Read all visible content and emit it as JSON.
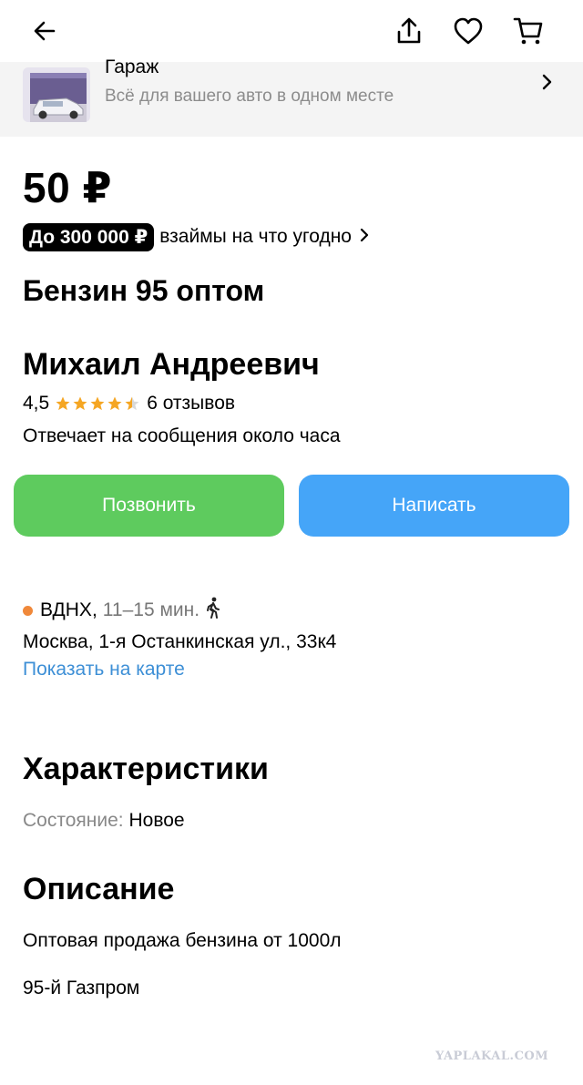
{
  "toolbar": {
    "back_icon": "back-arrow-icon",
    "share_icon": "share-icon",
    "favorite_icon": "heart-icon",
    "cart_icon": "cart-icon"
  },
  "promo": {
    "title": "Гараж",
    "subtitle": "Всё для вашего авто в одном месте"
  },
  "listing": {
    "price": "50 ₽",
    "loan_badge": "До 300 000 ₽",
    "loan_text": "взаймы на что угодно",
    "title": "Бензин 95 оптом"
  },
  "seller": {
    "name": "Михаил Андреевич",
    "rating": "4,5",
    "rating_value": 4.5,
    "reviews": "6 отзывов",
    "response": "Отвечает на сообщения около часа"
  },
  "actions": {
    "call_label": "Позвонить",
    "write_label": "Написать"
  },
  "location": {
    "metro": "ВДНХ,",
    "time": "11–15 мин.",
    "address": "Москва, 1-я Останкинская ул., 33к4",
    "map_link": "Показать на карте"
  },
  "specs": {
    "heading": "Характеристики",
    "condition_key": "Состояние:",
    "condition_value": "Новое"
  },
  "description": {
    "heading": "Описание",
    "line1": "Оптовая продажа бензина от 1000л",
    "line2": "95-й Газпром"
  },
  "watermark": "YAPLAKAL.COM",
  "colors": {
    "call": "#5ecb5e",
    "write": "#45a5f8",
    "link": "#3d8fd6",
    "metro_dot": "#f0883a",
    "star": "#f5a623"
  }
}
